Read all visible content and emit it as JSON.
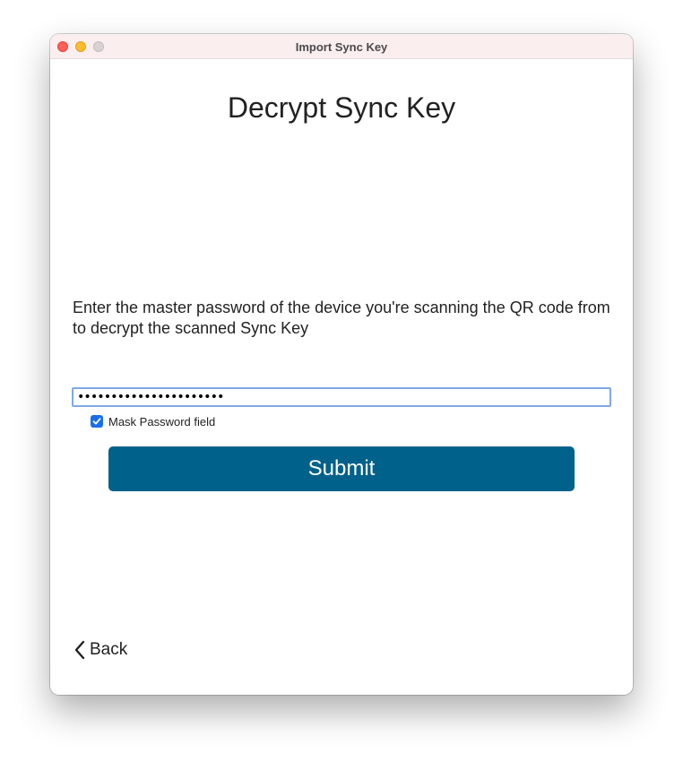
{
  "window": {
    "title": "Import Sync Key"
  },
  "page": {
    "heading": "Decrypt Sync Key",
    "instructions": "Enter the master password of the device you're scanning the QR code from to decrypt the scanned Sync Key"
  },
  "password": {
    "value": "••••••••••••••••••••••",
    "masked": true
  },
  "mask_checkbox": {
    "label": "Mask Password field",
    "checked": true
  },
  "submit": {
    "label": "Submit"
  },
  "back": {
    "label": "Back"
  },
  "colors": {
    "accent": "#00618a",
    "checkbox": "#1a6fe8",
    "focus_ring": "#7fa9e6"
  }
}
